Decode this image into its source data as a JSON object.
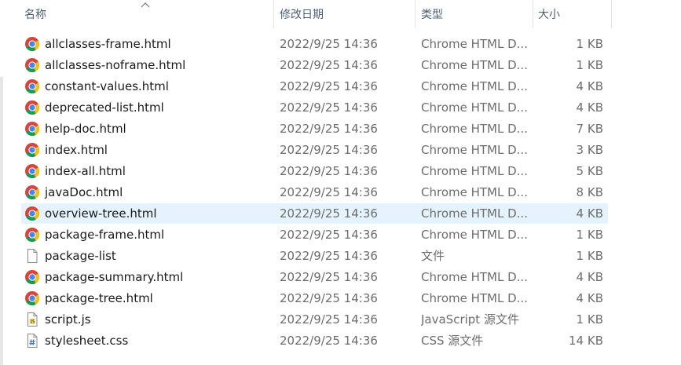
{
  "columns": {
    "name": "名称",
    "date": "修改日期",
    "type": "类型",
    "size": "大小"
  },
  "rows": [
    {
      "name": "allclasses-frame.html",
      "date": "2022/9/25 14:36",
      "type": "Chrome HTML D...",
      "size": "1 KB",
      "icon": "chrome-icon"
    },
    {
      "name": "allclasses-noframe.html",
      "date": "2022/9/25 14:36",
      "type": "Chrome HTML D...",
      "size": "1 KB",
      "icon": "chrome-icon"
    },
    {
      "name": "constant-values.html",
      "date": "2022/9/25 14:36",
      "type": "Chrome HTML D...",
      "size": "4 KB",
      "icon": "chrome-icon"
    },
    {
      "name": "deprecated-list.html",
      "date": "2022/9/25 14:36",
      "type": "Chrome HTML D...",
      "size": "4 KB",
      "icon": "chrome-icon"
    },
    {
      "name": "help-doc.html",
      "date": "2022/9/25 14:36",
      "type": "Chrome HTML D...",
      "size": "7 KB",
      "icon": "chrome-icon"
    },
    {
      "name": "index.html",
      "date": "2022/9/25 14:36",
      "type": "Chrome HTML D...",
      "size": "3 KB",
      "icon": "chrome-icon"
    },
    {
      "name": "index-all.html",
      "date": "2022/9/25 14:36",
      "type": "Chrome HTML D...",
      "size": "5 KB",
      "icon": "chrome-icon"
    },
    {
      "name": "javaDoc.html",
      "date": "2022/9/25 14:36",
      "type": "Chrome HTML D...",
      "size": "8 KB",
      "icon": "chrome-icon"
    },
    {
      "name": "overview-tree.html",
      "date": "2022/9/25 14:36",
      "type": "Chrome HTML D...",
      "size": "4 KB",
      "icon": "chrome-icon",
      "selected": true
    },
    {
      "name": "package-frame.html",
      "date": "2022/9/25 14:36",
      "type": "Chrome HTML D...",
      "size": "1 KB",
      "icon": "chrome-icon"
    },
    {
      "name": "package-list",
      "date": "2022/9/25 14:36",
      "type": "文件",
      "size": "1 KB",
      "icon": "file-icon"
    },
    {
      "name": "package-summary.html",
      "date": "2022/9/25 14:36",
      "type": "Chrome HTML D...",
      "size": "4 KB",
      "icon": "chrome-icon"
    },
    {
      "name": "package-tree.html",
      "date": "2022/9/25 14:36",
      "type": "Chrome HTML D...",
      "size": "4 KB",
      "icon": "chrome-icon"
    },
    {
      "name": "script.js",
      "date": "2022/9/25 14:36",
      "type": "JavaScript 源文件",
      "size": "1 KB",
      "icon": "js-file-icon"
    },
    {
      "name": "stylesheet.css",
      "date": "2022/9/25 14:36",
      "type": "CSS 源文件",
      "size": "14 KB",
      "icon": "css-file-icon"
    }
  ],
  "colors": {
    "header_text": "#4c607a",
    "selected_bg": "#e5f3ff",
    "chrome_red": "#db4437",
    "chrome_yellow": "#f4c20d",
    "chrome_green": "#0f9d58",
    "chrome_blue": "#4285f4"
  }
}
